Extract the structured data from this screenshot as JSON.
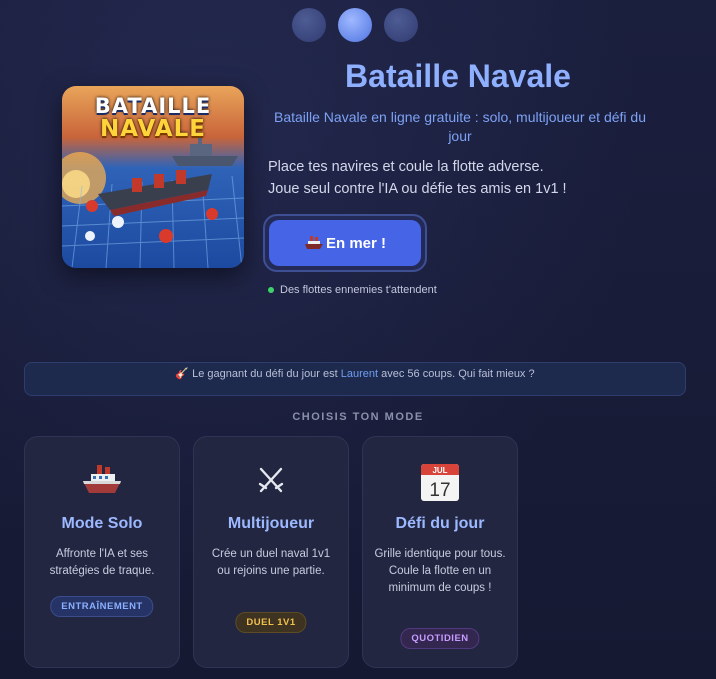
{
  "cover": {
    "line1": "BATAILLE",
    "line2": "NAVALE"
  },
  "title": "Bataille Navale",
  "subtitle": "Bataille Navale en ligne gratuite : solo, multijoueur et défi du jour",
  "description": {
    "line1": "Place tes navires et coule la flotte adverse.",
    "line2": "Joue seul contre l'IA ou défie tes amis en 1v1 !"
  },
  "play_button": {
    "label": "En mer !",
    "icon": "ship-icon"
  },
  "status": {
    "text": "Des flottes ennemies t'attendent",
    "color": "#3fd46a"
  },
  "banner": {
    "icon": "guitar-icon",
    "prefix": "Le gagnant du défi du jour est",
    "winner": "Laurent",
    "suffix": "avec 56 coups. Qui fait mieux ?"
  },
  "mode_heading": "CHOISIS TON MODE",
  "pager": {
    "count": 3,
    "active": 1
  },
  "modes": [
    {
      "icon": "ship-icon",
      "title": "Mode Solo",
      "desc": "Affronte l'IA et ses stratégies de traque.",
      "badge": "ENTRAÎNEMENT",
      "badge_color": "#8ab0ff"
    },
    {
      "icon": "crossed-swords-icon",
      "title": "Multijoueur",
      "desc": "Crée un duel naval 1v1 ou rejoins une partie.",
      "badge": "DUEL 1V1",
      "badge_color": "#f2c04e"
    },
    {
      "icon": "calendar-icon",
      "title": "Défi du jour",
      "desc": "Grille identique pour tous. Coule la flotte en un minimum de coups !",
      "badge": "QUOTIDIEN",
      "badge_color": "#c79bff",
      "calendar": {
        "month": "JUL",
        "day": "17"
      }
    }
  ],
  "colors": {
    "accent": "#4664e6",
    "title": "#8fb0ff",
    "background": "#171a35"
  }
}
